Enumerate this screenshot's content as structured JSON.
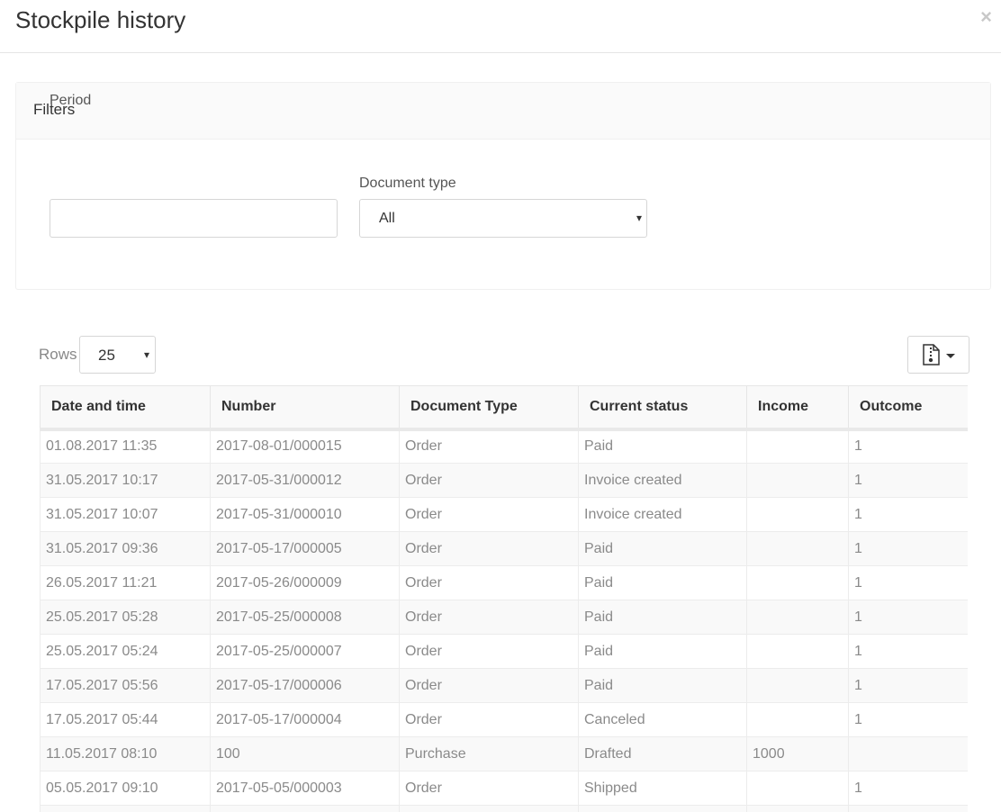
{
  "modal": {
    "title": "Stockpile history",
    "close_glyph": "×"
  },
  "filters": {
    "heading": "Filters",
    "period_label": "Period",
    "period_value": "",
    "doctype_label": "Document type",
    "doctype_selected": "All"
  },
  "table_controls": {
    "rows_label": "Rows",
    "rows_selected": "25",
    "export_icon": "file-zip-icon"
  },
  "table": {
    "columns": [
      "Date and time",
      "Number",
      "Document Type",
      "Current status",
      "Income",
      "Outcome"
    ],
    "rows": [
      [
        "01.08.2017 11:35",
        "2017-08-01/000015",
        "Order",
        "Paid",
        "",
        "1"
      ],
      [
        "31.05.2017 10:17",
        "2017-05-31/000012",
        "Order",
        "Invoice created",
        "",
        "1"
      ],
      [
        "31.05.2017 10:07",
        "2017-05-31/000010",
        "Order",
        "Invoice created",
        "",
        "1"
      ],
      [
        "31.05.2017 09:36",
        "2017-05-17/000005",
        "Order",
        "Paid",
        "",
        "1"
      ],
      [
        "26.05.2017 11:21",
        "2017-05-26/000009",
        "Order",
        "Paid",
        "",
        "1"
      ],
      [
        "25.05.2017 05:28",
        "2017-05-25/000008",
        "Order",
        "Paid",
        "",
        "1"
      ],
      [
        "25.05.2017 05:24",
        "2017-05-25/000007",
        "Order",
        "Paid",
        "",
        "1"
      ],
      [
        "17.05.2017 05:56",
        "2017-05-17/000006",
        "Order",
        "Paid",
        "",
        "1"
      ],
      [
        "17.05.2017 05:44",
        "2017-05-17/000004",
        "Order",
        "Canceled",
        "",
        "1"
      ],
      [
        "11.05.2017 08:10",
        "100",
        "Purchase",
        "Drafted",
        "1000",
        ""
      ],
      [
        "05.05.2017 09:10",
        "2017-05-05/000003",
        "Order",
        "Shipped",
        "",
        "1"
      ],
      [
        "",
        "",
        "",
        "",
        "",
        ""
      ]
    ]
  }
}
